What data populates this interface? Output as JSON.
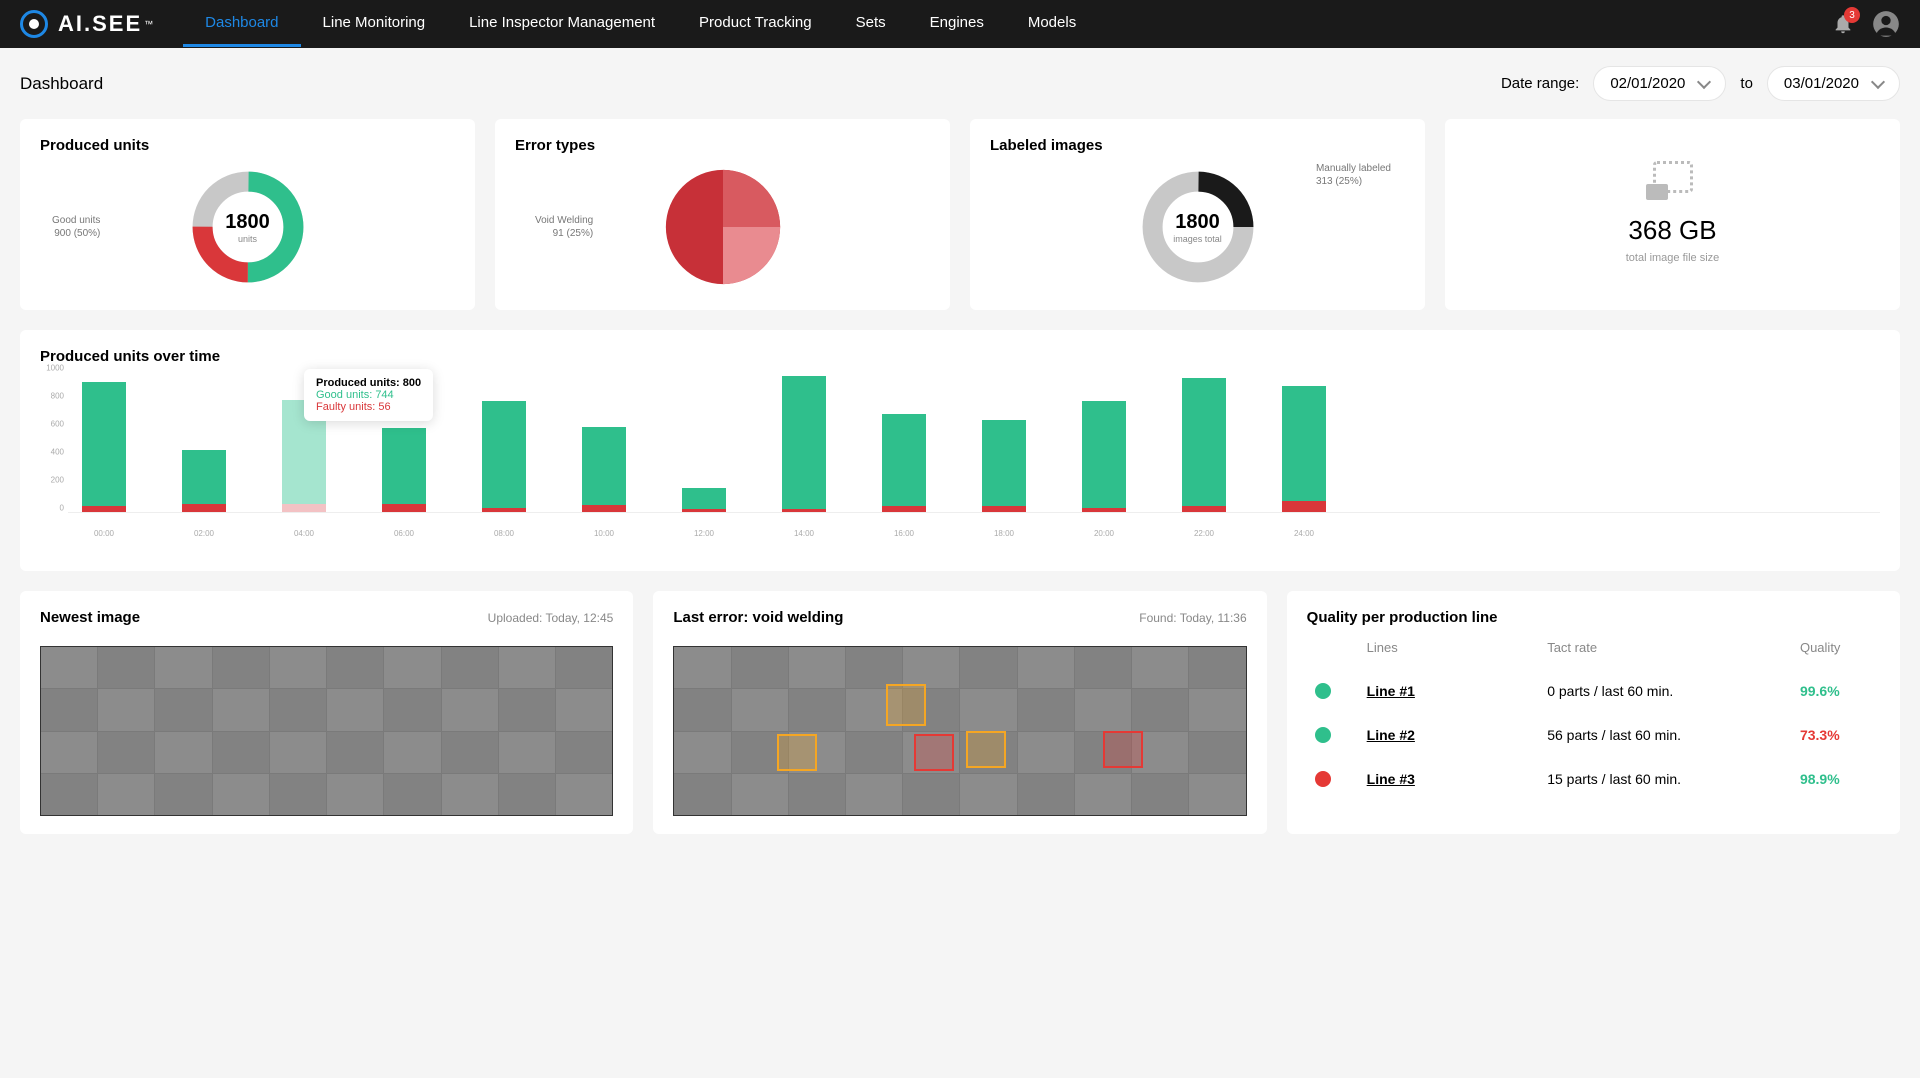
{
  "brand": {
    "name": "AI.SEE",
    "tm": "™"
  },
  "nav": [
    "Dashboard",
    "Line Monitoring",
    "Line Inspector Management",
    "Product Tracking",
    "Sets",
    "Engines",
    "Models"
  ],
  "active_nav": 0,
  "notifications": "3",
  "page_title": "Dashboard",
  "date_range": {
    "label": "Date range:",
    "from": "02/01/2020",
    "to_label": "to",
    "to": "03/01/2020"
  },
  "cards": {
    "produced": {
      "title": "Produced units",
      "side_label": "Good units",
      "side_val": "900 (50%)",
      "center": "1800",
      "center_sub": "units"
    },
    "errors": {
      "title": "Error types",
      "side_label": "Void Welding",
      "side_val": "91 (25%)"
    },
    "labeled": {
      "title": "Labeled images",
      "center": "1800",
      "center_sub": "images total",
      "right_label": "Manually labeled",
      "right_val": "313 (25%)"
    },
    "storage": {
      "value": "368 GB",
      "label": "total image file size"
    }
  },
  "chart": {
    "title": "Produced units over time"
  },
  "chart_data": {
    "type": "bar",
    "ylim": [
      0,
      1000
    ],
    "yticks": [
      0,
      200,
      400,
      600,
      800,
      1000
    ],
    "categories": [
      "00:00",
      "02:00",
      "04:00",
      "06:00",
      "08:00",
      "10:00",
      "12:00",
      "14:00",
      "16:00",
      "18:00",
      "20:00",
      "22:00",
      "24:00"
    ],
    "series": [
      {
        "name": "Good units",
        "values": [
          890,
          380,
          744,
          540,
          760,
          560,
          150,
          950,
          660,
          620,
          760,
          920,
          820
        ]
      },
      {
        "name": "Faulty units",
        "values": [
          40,
          60,
          56,
          60,
          30,
          50,
          20,
          20,
          40,
          40,
          30,
          40,
          80
        ]
      }
    ],
    "tooltip": {
      "index": 2,
      "title": "Produced units: 800",
      "good": "Good units: 744",
      "bad": "Faulty units: 56"
    }
  },
  "newest": {
    "title": "Newest image",
    "meta": "Uploaded: Today, 12:45"
  },
  "lasterr": {
    "title": "Last error: void welding",
    "meta": "Found: Today, 11:36"
  },
  "quality": {
    "title": "Quality per production line",
    "headers": [
      "Lines",
      "Tact rate",
      "Quality"
    ],
    "rows": [
      {
        "dot": "g",
        "line": "Line #1",
        "tact": "0 parts / last 60 min.",
        "q": "99.6%",
        "good": true
      },
      {
        "dot": "g",
        "line": "Line #2",
        "tact": "56 parts / last 60 min.",
        "q": "73.3%",
        "good": false
      },
      {
        "dot": "r",
        "line": "Line #3",
        "tact": "15 parts / last 60 min.",
        "q": "98.9%",
        "good": true
      }
    ]
  }
}
